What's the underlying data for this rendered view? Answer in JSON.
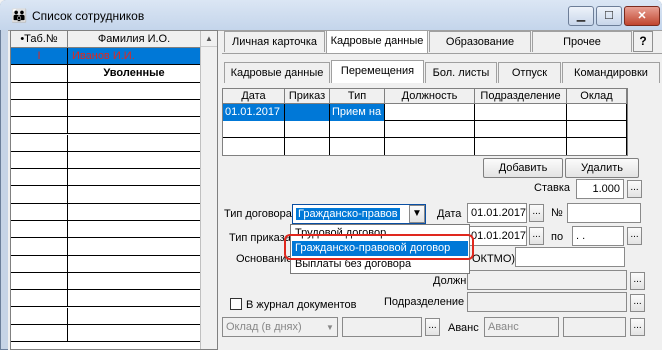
{
  "window": {
    "title": "Список сотрудников"
  },
  "employee_grid": {
    "headers": [
      "•Таб.№",
      "Фамилия И.О."
    ],
    "rows": [
      {
        "num": "I",
        "name": "Иванов И.И."
      },
      {
        "num": "",
        "name": "Уволенные"
      }
    ]
  },
  "main_tabs": [
    "Личная карточка",
    "Кадровые данные",
    "Образование",
    "Прочее"
  ],
  "help_label": "?",
  "sub_tabs": [
    "Кадровые данные",
    "Перемещения",
    "Бол. листы",
    "Отпуск",
    "Командировки"
  ],
  "moves_table": {
    "headers": [
      "Дата",
      "Приказ",
      "Тип",
      "Должность",
      "Подразделение",
      "Оклад"
    ],
    "rows": [
      {
        "date": "01.01.2017",
        "order": "",
        "type": "Прием на",
        "position": "",
        "dept": "",
        "salary": ""
      }
    ]
  },
  "buttons": {
    "add": "Добавить",
    "delete": "Удалить",
    "dots": "..."
  },
  "form": {
    "rate_label": "Ставка",
    "rate_value": "1.000",
    "contract_type_label": "Тип договора",
    "contract_type_value": "Гражданско-правов",
    "date_label": "Дата",
    "date_value": "01.01.2017",
    "number_label": "№",
    "number_value": "",
    "order_type_label": "Тип приказа",
    "order_date_value": "01.01.2017",
    "to_label": "по",
    "to_value": ". .",
    "basis_label": "Основание",
    "oktmo_label": "ОКТМО)",
    "position_label": "Должн.",
    "dept_label": "Подразделение",
    "journal_label": "В журнал документов",
    "salary_mode_value": "Оклад (в днях)",
    "advance_label": "Аванс",
    "advance_value": "Аванс"
  },
  "dropdown_options": [
    "Трудовой договор",
    "Гражданско-правовой договор",
    "Выплаты без договора"
  ],
  "colors": {
    "selected": "#0078d7",
    "red_text": "#e0281e",
    "highlight_oval": "#e0281e"
  }
}
